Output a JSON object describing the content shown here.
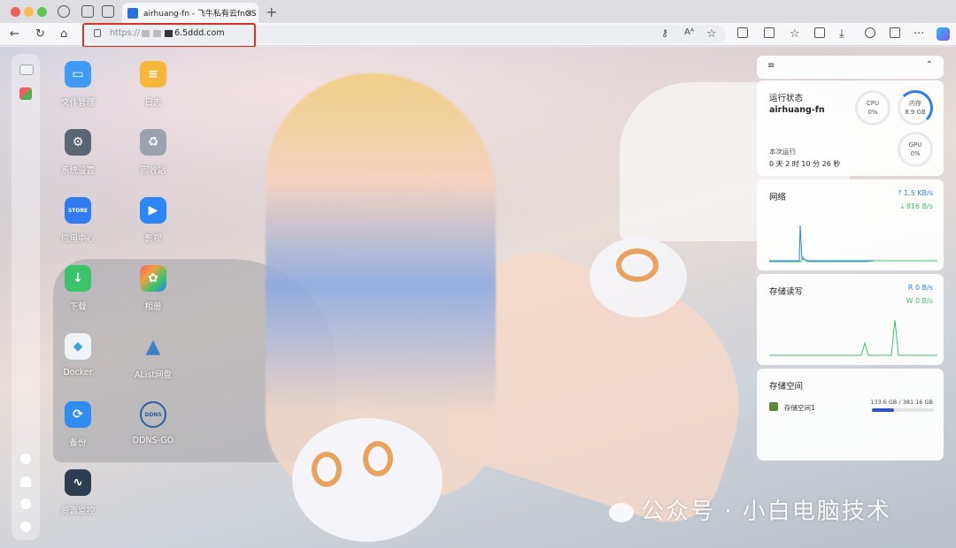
{
  "browser": {
    "tab_title": "airhuang-fn - 飞牛私有云fnOS",
    "tab_close": "×",
    "new_tab": "+",
    "url_prefix": "https://",
    "url_suffix": "6.5ddd.com"
  },
  "desktop_apps": [
    {
      "label": "文件管理",
      "icon": "folder-icon",
      "color": "#3d9bf5"
    },
    {
      "label": "日志",
      "icon": "log-icon",
      "color": "#f6b63a"
    },
    {
      "label": "系统设置",
      "icon": "settings-icon",
      "color": "#5c6573"
    },
    {
      "label": "回收站",
      "icon": "recycle-bin-icon",
      "color": "#9aa3ad"
    },
    {
      "label": "应用中心",
      "icon": "store-icon",
      "color": "#2f7bef"
    },
    {
      "label": "影视",
      "icon": "video-icon",
      "color": "#2d86f5"
    },
    {
      "label": "下载",
      "icon": "download-icon",
      "color": "#3bc36a"
    },
    {
      "label": "相册",
      "icon": "photos-icon",
      "color": "#f0a040"
    },
    {
      "label": "Docker",
      "icon": "docker-icon",
      "color": "#3aa3d8"
    },
    {
      "label": "AList网盘",
      "icon": "alist-icon",
      "color": "#3b82c4"
    },
    {
      "label": "备份",
      "icon": "backup-icon",
      "color": "#2f8cf0"
    },
    {
      "label": "DDNS-GO",
      "icon": "ddns-icon",
      "color": "#2b5f9e"
    },
    {
      "label": "资源监控",
      "icon": "resource-monitor-icon",
      "color": "#2c3e50"
    }
  ],
  "widgets": {
    "status": {
      "title": "运行状态",
      "hostname": "airhuang-fn",
      "cpu_label": "CPU",
      "cpu_value": "0%",
      "mem_label": "内存",
      "mem_value": "8.9 GB",
      "gpu_label": "GPU",
      "gpu_value": "0%",
      "uptime_label": "本次运行",
      "uptime_value": "0 天 2 时 10 分 26 秒"
    },
    "network": {
      "title": "网络",
      "up": "1.5 KB/s",
      "down": "816 B/s",
      "up_color": "#2f7bef",
      "down_color": "#3bc36a"
    },
    "disk_io": {
      "title": "存储读写",
      "read": "R 0 B/s",
      "write": "W 0 B/s"
    },
    "storage": {
      "title": "存储空间",
      "volume_name": "存储空间1",
      "usage": "133.6 GB / 381.16 GB",
      "used_fraction": 0.35
    }
  },
  "watermark": "公众号 · 小白电脑技术"
}
